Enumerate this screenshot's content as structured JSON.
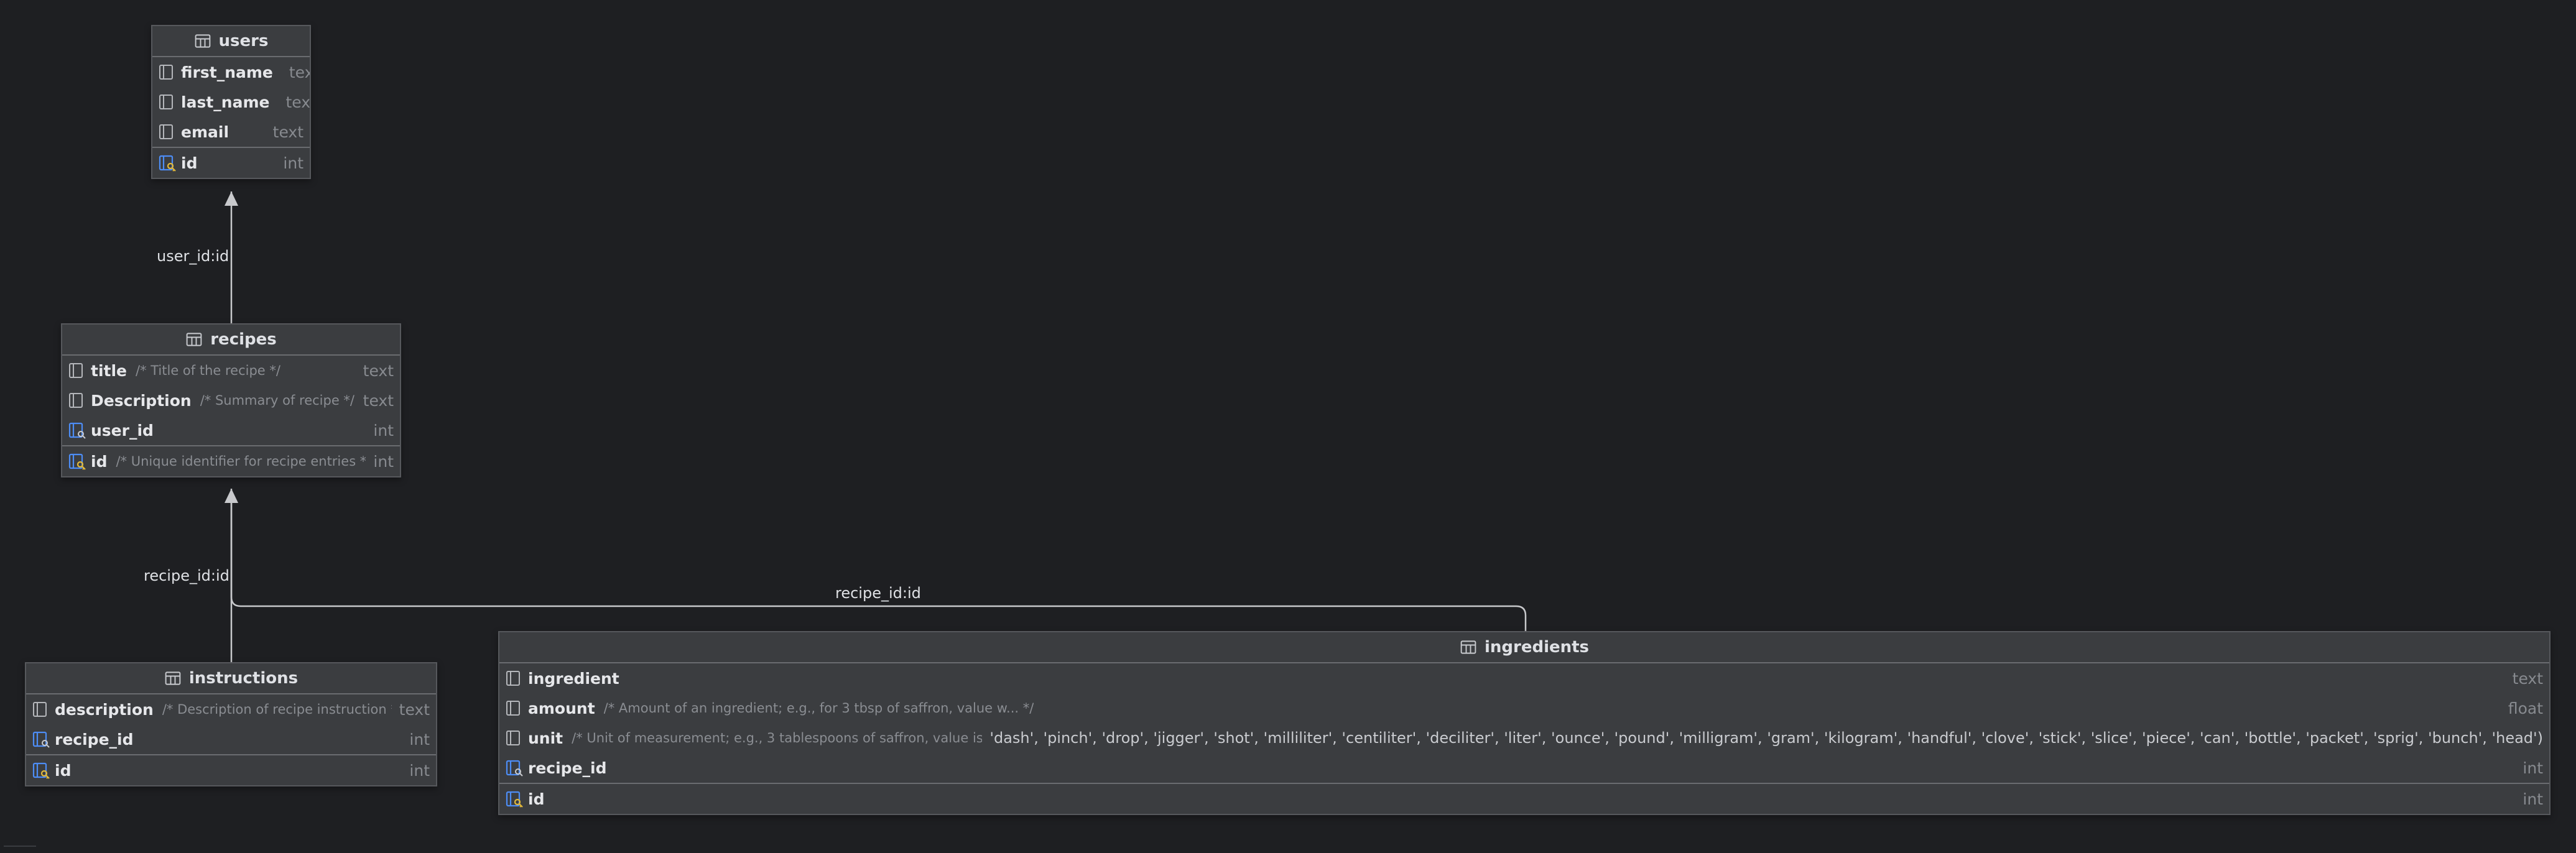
{
  "diagram": {
    "tables": [
      {
        "key": "users",
        "title": "users",
        "icon": "table-icon",
        "columns": [
          {
            "name": "first_name",
            "comment": "",
            "type": "text",
            "icon": "column-icon"
          },
          {
            "name": "last_name",
            "comment": "",
            "type": "text",
            "icon": "column-icon"
          },
          {
            "name": "email",
            "comment": "",
            "type": "text",
            "icon": "column-icon"
          },
          {
            "name": "id",
            "comment": "",
            "type": "int",
            "icon": "primary-key-icon",
            "pk": true
          }
        ]
      },
      {
        "key": "recipes",
        "title": "recipes",
        "icon": "table-icon",
        "columns": [
          {
            "name": "title",
            "comment": "/* Title of the recipe */",
            "type": "text",
            "icon": "column-icon"
          },
          {
            "name": "Description",
            "comment": "/* Summary of recipe */",
            "type": "text",
            "icon": "column-icon"
          },
          {
            "name": "user_id",
            "comment": "",
            "type": "int",
            "icon": "foreign-key-icon"
          },
          {
            "name": "id",
            "comment": "/* Unique identifier for recipe entries */",
            "type": "int",
            "icon": "primary-key-icon",
            "pk": true
          }
        ]
      },
      {
        "key": "instructions",
        "title": "instructions",
        "icon": "table-icon",
        "columns": [
          {
            "name": "description",
            "comment": "/* Description of recipe instruction */",
            "type": "text",
            "icon": "column-icon"
          },
          {
            "name": "recipe_id",
            "comment": "",
            "type": "int",
            "icon": "foreign-key-icon"
          },
          {
            "name": "id",
            "comment": "",
            "type": "int",
            "icon": "primary-key-icon",
            "pk": true
          }
        ]
      },
      {
        "key": "ingredients",
        "title": "ingredients",
        "icon": "table-icon",
        "columns": [
          {
            "name": "ingredient",
            "comment": "",
            "type": "text",
            "icon": "column-icon"
          },
          {
            "name": "amount",
            "comment": "/* Amount of an ingredient; e.g., for 3 tbsp of saffron, value w... */",
            "type": "float",
            "icon": "column-icon"
          },
          {
            "name": "unit",
            "comment": "/* Unit of measurement; e.g., 3 tablespoons of saffron, value is... */",
            "enum_values": "'dash', 'pinch', 'drop', 'jigger', 'shot', 'milliliter', 'centiliter', 'deciliter', 'liter', 'ounce', 'pound', 'milligram', 'gram', 'kilogram', 'handful', 'clove', 'stick', 'slice', 'piece', 'can', 'bottle', 'packet', 'sprig', 'bunch', 'head')",
            "type": "",
            "icon": "column-icon"
          },
          {
            "name": "recipe_id",
            "comment": "",
            "type": "int",
            "icon": "foreign-key-icon"
          },
          {
            "name": "id",
            "comment": "",
            "type": "int",
            "icon": "primary-key-icon",
            "pk": true
          }
        ]
      }
    ],
    "relations": [
      {
        "label": "user_id:id"
      },
      {
        "label": "recipe_id:id"
      },
      {
        "label": "recipe_id:id"
      }
    ],
    "colors": {
      "background": "#1e1f22",
      "table": "#3b3d40",
      "edge": "#c8c9cc",
      "key_icon": "#4d8df5"
    }
  }
}
